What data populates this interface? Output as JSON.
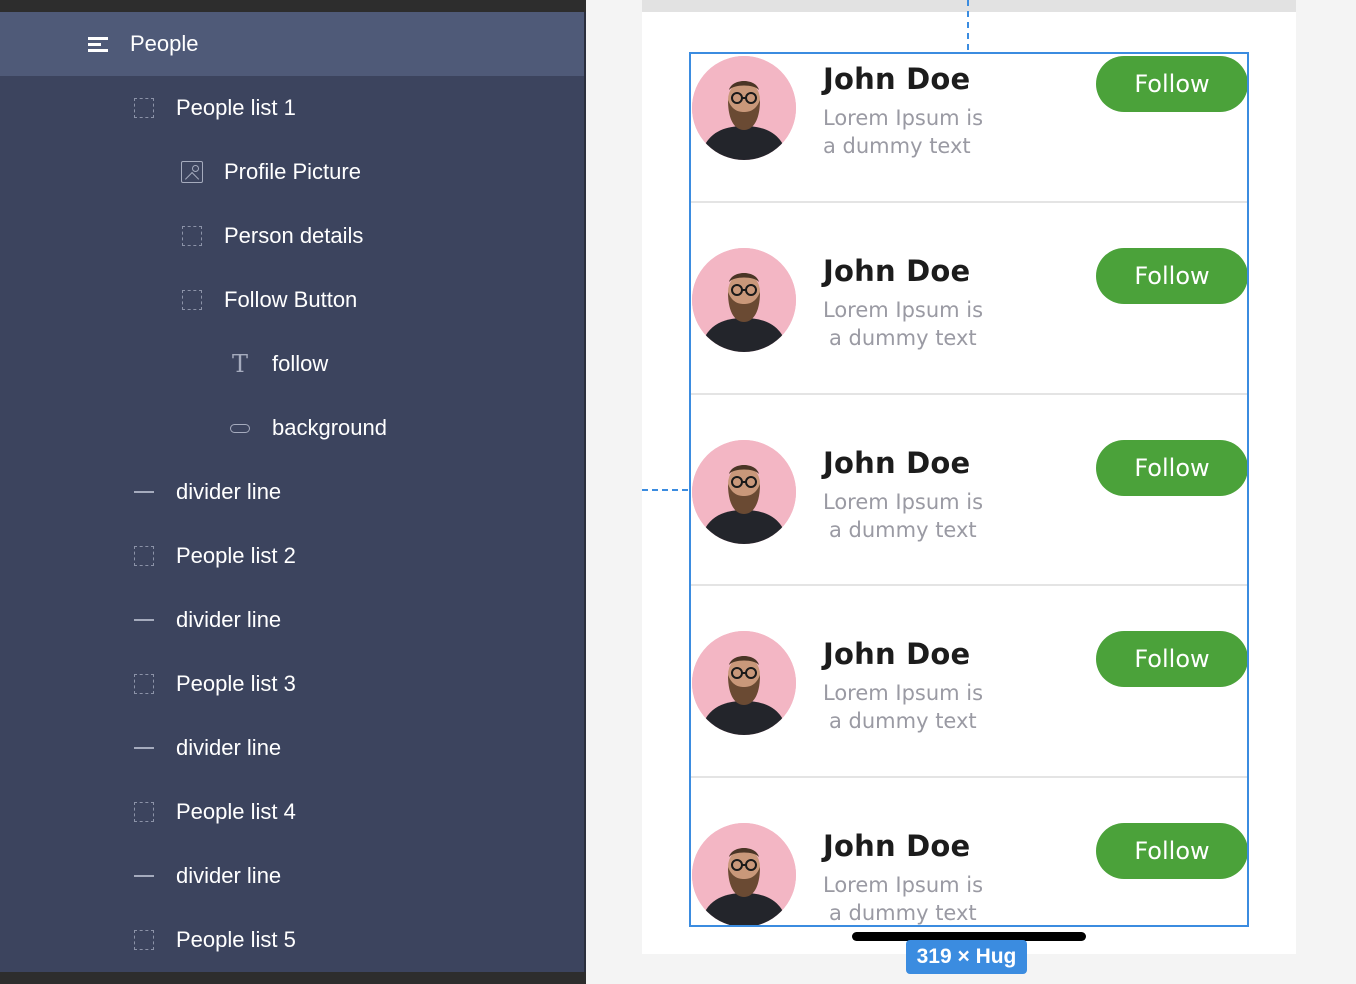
{
  "layers": {
    "root": {
      "label": "People",
      "icon": "stack-layout-icon"
    },
    "items": [
      {
        "label": "People list 1",
        "icon": "frame-icon"
      },
      {
        "label": "Profile Picture",
        "icon": "image-icon"
      },
      {
        "label": "Person details",
        "icon": "frame-icon"
      },
      {
        "label": "Follow Button",
        "icon": "frame-icon"
      },
      {
        "label": "follow",
        "icon": "text-icon"
      },
      {
        "label": "background",
        "icon": "rectangle-icon"
      },
      {
        "label": "divider line",
        "icon": "line-icon"
      },
      {
        "label": "People list 2",
        "icon": "frame-icon"
      },
      {
        "label": "divider line",
        "icon": "line-icon"
      },
      {
        "label": "People list 3",
        "icon": "frame-icon"
      },
      {
        "label": "divider line",
        "icon": "line-icon"
      },
      {
        "label": "People list 4",
        "icon": "frame-icon"
      },
      {
        "label": "divider line",
        "icon": "line-icon"
      },
      {
        "label": "People list 5",
        "icon": "frame-icon"
      }
    ]
  },
  "people": [
    {
      "name": "John Doe",
      "desc_line1": "Lorem Ipsum is",
      "desc_line2": "a dummy text",
      "follow_label": "Follow"
    },
    {
      "name": "John Doe",
      "desc_line1": "Lorem Ipsum is",
      "desc_line2": "a dummy text",
      "follow_label": "Follow"
    },
    {
      "name": "John Doe",
      "desc_line1": "Lorem Ipsum is",
      "desc_line2": "a dummy text",
      "follow_label": "Follow"
    },
    {
      "name": "John Doe",
      "desc_line1": "Lorem Ipsum is",
      "desc_line2": "a dummy text",
      "follow_label": "Follow"
    },
    {
      "name": "John Doe",
      "desc_line1": "Lorem Ipsum is",
      "desc_line2": "a dummy text",
      "follow_label": "Follow"
    }
  ],
  "size_badge": "319 × Hug",
  "colors": {
    "panel_bg": "#3c445e",
    "selected_bg": "#4f5a78",
    "accent_blue": "#3b8ce0",
    "follow_green": "#4ba23a",
    "avatar_bg": "#f3b6c4"
  }
}
